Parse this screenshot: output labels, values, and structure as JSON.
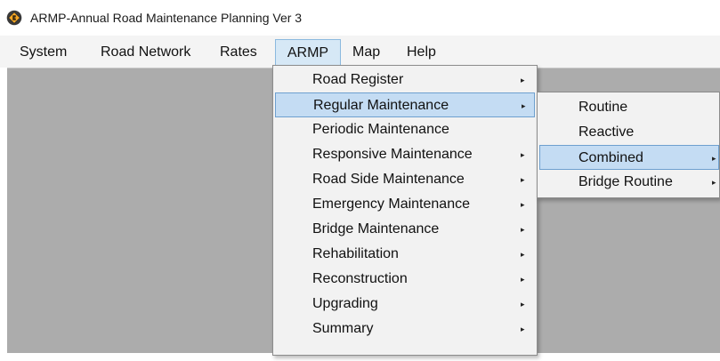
{
  "window": {
    "title": "ARMP-Annual Road Maintenance Planning Ver 3",
    "icon": "road-sign-icon"
  },
  "menubar": {
    "items": [
      {
        "label": "System"
      },
      {
        "label": "Road Network"
      },
      {
        "label": "Rates"
      },
      {
        "label": "ARMP",
        "active": true
      },
      {
        "label": "Map"
      },
      {
        "label": "Help"
      }
    ]
  },
  "armp_menu": {
    "items": [
      {
        "label": "Road Register",
        "has_submenu": true
      },
      {
        "label": "Regular Maintenance",
        "has_submenu": true,
        "highlighted": true
      },
      {
        "label": "Periodic Maintenance",
        "has_submenu": false
      },
      {
        "label": "Responsive Maintenance",
        "has_submenu": true
      },
      {
        "label": "Road Side Maintenance",
        "has_submenu": true
      },
      {
        "label": "Emergency Maintenance",
        "has_submenu": true
      },
      {
        "label": "Bridge Maintenance",
        "has_submenu": true
      },
      {
        "label": "Rehabilitation",
        "has_submenu": true
      },
      {
        "label": "Reconstruction",
        "has_submenu": true
      },
      {
        "label": "Upgrading",
        "has_submenu": true
      },
      {
        "label": "Summary",
        "has_submenu": true
      }
    ]
  },
  "regular_maintenance_menu": {
    "items": [
      {
        "label": "Routine",
        "has_submenu": false
      },
      {
        "label": "Reactive",
        "has_submenu": false
      },
      {
        "label": "Combined",
        "has_submenu": true,
        "highlighted": true
      },
      {
        "label": "Bridge Routine",
        "has_submenu": true
      }
    ]
  },
  "submenu_arrow": "▸",
  "colors": {
    "menubar_bg": "#f4f4f4",
    "workspace_bg": "#acacac",
    "menu_bg": "#f2f2f2",
    "highlight_bg": "#c4dcf3",
    "highlight_border": "#6ea0cf",
    "active_menubar_bg": "#d6e8f6"
  }
}
